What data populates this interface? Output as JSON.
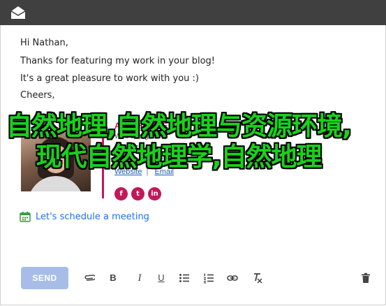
{
  "window": {
    "app_icon": "mail-open-icon",
    "title_bar_color": "#404040"
  },
  "email": {
    "greeting": "Hi Nathan,",
    "line1": "Thanks for featuring my work in your blog!",
    "line2": "It's a great pleasure to work with you :)",
    "signoff": "Cheers,"
  },
  "signature": {
    "name": "AMY HOUSE",
    "role": "Web Designer",
    "contact": "Acme Studio",
    "phone": "+1-202-555-0147",
    "website_label": "Website",
    "email_label": "Email",
    "social": [
      {
        "icon": "facebook-icon",
        "glyph": "f"
      },
      {
        "icon": "twitter-icon",
        "glyph": "t"
      },
      {
        "icon": "linkedin-icon",
        "glyph": "in"
      }
    ],
    "accent_color": "#c2185b"
  },
  "overlay_text": "自然地理,自然地理与资源环境,现代自然地理学,自然地理",
  "schedule": {
    "label": "Let's schedule a meeting",
    "icon": "calendar-icon"
  },
  "toolbar": {
    "send_label": "SEND",
    "icons": [
      "attach-icon",
      "bold-icon",
      "italic-icon",
      "underline-icon",
      "bullet-list-icon",
      "numbered-list-icon",
      "link-icon",
      "clear-format-icon",
      "trash-icon"
    ]
  }
}
